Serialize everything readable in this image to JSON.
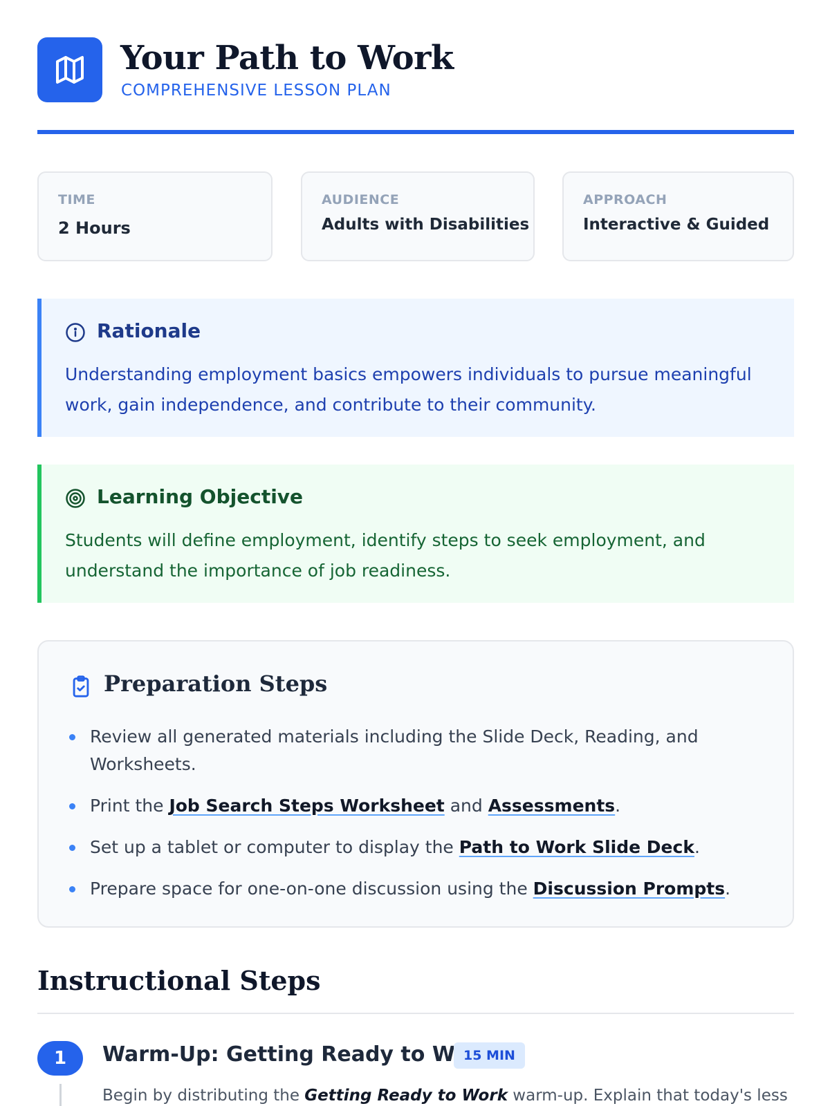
{
  "header": {
    "title": "Your Path to Work",
    "subtitle": "COMPREHENSIVE LESSON PLAN",
    "logo_icon": "map-icon",
    "accent_color": "#2563eb"
  },
  "meta": [
    {
      "label": "TIME",
      "value": "2 Hours"
    },
    {
      "label": "AUDIENCE",
      "value": "Adults with Disabilities"
    },
    {
      "label": "APPROACH",
      "value": "Interactive & Guided"
    }
  ],
  "rationale": {
    "icon": "info-icon",
    "title": "Rationale",
    "body": "Understanding employment basics empowers individuals to pursue meaningful work, gain independence, and contribute to their community."
  },
  "objective": {
    "icon": "target-icon",
    "title": "Learning Objective",
    "body": "Students will define employment, identify steps to seek employment, and understand the importance of job readiness."
  },
  "preparation": {
    "icon": "clipboard-check-icon",
    "title": "Preparation Steps",
    "items": [
      {
        "text": "Review all generated materials including the Slide Deck, Reading, and Worksheets."
      },
      {
        "before": "Print the ",
        "link1": "Job Search Steps Worksheet",
        "middle": " and ",
        "link2": "Assessments",
        "after": "."
      },
      {
        "before": "Set up a tablet or computer to display the ",
        "link1": "Path to Work Slide Deck",
        "after": "."
      },
      {
        "before": "Prepare space for one-on-one discussion using the ",
        "link1": "Discussion Prompts",
        "after": "."
      }
    ]
  },
  "instructional": {
    "title": "Instructional Steps",
    "steps": [
      {
        "number": "1",
        "title": "Warm-Up: Getting Ready to Work",
        "duration": "15 MIN",
        "body_before": "Begin by distributing the ",
        "body_emphasis": "Getting Ready to Work",
        "body_after": " warm-up. Explain that today's lesson is"
      }
    ]
  }
}
